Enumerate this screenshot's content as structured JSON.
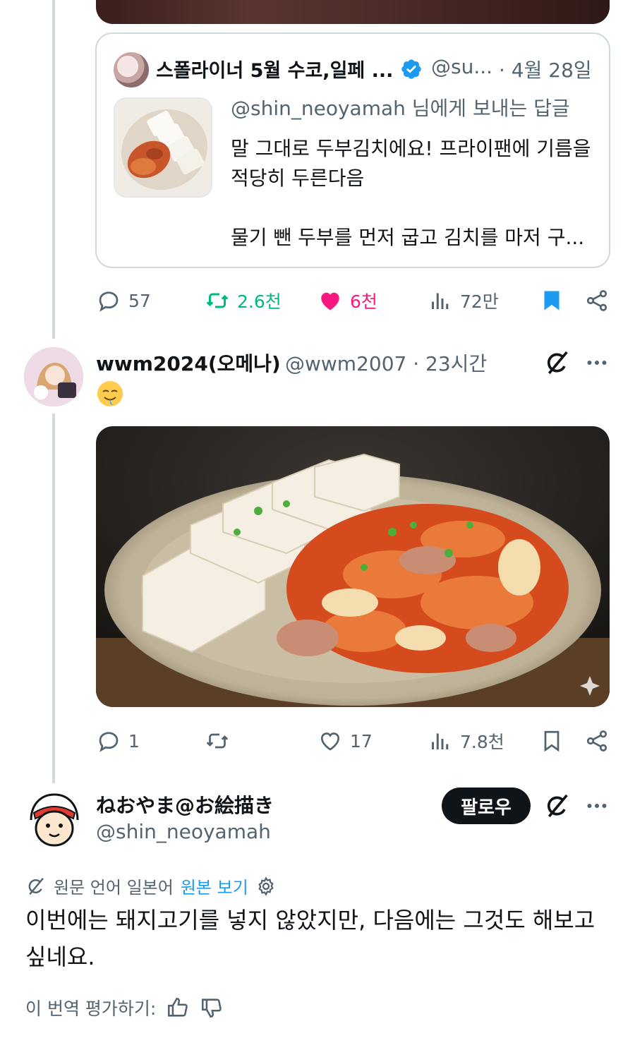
{
  "quote": {
    "author_name": "스폴라이너 5월 수코,일페 ...",
    "handle": "@su...",
    "date": "· 4월 28일",
    "reply_to": "@shin_neoyamah 님에게 보내는 답글",
    "text": "말 그대로 두부김치에요! 프라이팬에 기름을 적당히 두른다음\n\n물기 뺀 두부를 먼저 굽고 김치를 마저 구..."
  },
  "tweet1_actions": {
    "replies": "57",
    "retweets": "2.6천",
    "likes": "6천",
    "views": "72만"
  },
  "tweet2": {
    "name": "wwm2024(오메나)",
    "handle": "@wwm2007 · 23시간",
    "emoji": "😋",
    "actions": {
      "replies": "1",
      "retweets": "",
      "likes": "17",
      "views": "7.8천"
    }
  },
  "tweet3": {
    "name": "ねおやま@お絵描き",
    "handle": "@shin_neoyamah",
    "follow_label": "팔로우",
    "translated_from": "원문 언어 일본어",
    "show_original": "원본 보기",
    "body": "이번에는 돼지고기를 넣지 않았지만, 다음에는 그것도 해보고 싶네요.",
    "rate_label": "이 번역 평가하기:"
  },
  "colors": {
    "retweet_green": "#00ba7c",
    "like_pink": "#f91880",
    "bookmark_blue": "#1d9bf0",
    "verified_blue": "#1d9bf0"
  }
}
